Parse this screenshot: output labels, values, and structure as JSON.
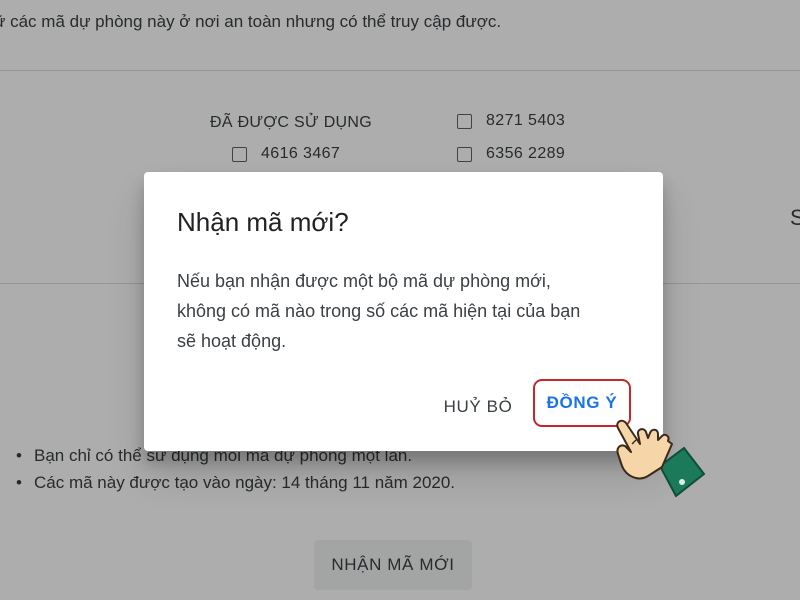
{
  "background": {
    "intro_text": "ữ các mã dự phòng này ở nơi an toàn nhưng có thể truy cập được.",
    "used_heading": "ĐÃ ĐƯỢC SỬ DỤNG",
    "codes": [
      "4616 3467",
      "8271 5403",
      "6356 2289"
    ],
    "notes": [
      "Bạn chỉ có thể sử dụng mỗi mã dự phòng một lần.",
      "Các mã này được tạo vào ngày: 14 tháng 11 năm 2020."
    ],
    "get_new_codes_label": "NHẬN MÃ MỚI",
    "right_edge_glyph": "S"
  },
  "dialog": {
    "title": "Nhận mã mới?",
    "body_lines": [
      "Nếu bạn nhận được một bộ mã dự phòng mới,",
      "không có mã nào trong số các mã hiện tại của bạn",
      "sẽ hoạt động."
    ],
    "cancel_label": "HUỶ BỎ",
    "ok_label": "ĐỒNG Ý"
  },
  "colors": {
    "accent": "#1a73e8",
    "highlight_outline": "#c62828",
    "scrim": "rgba(0,0,0,0.32)",
    "hand_skin": "#f6d6a8",
    "hand_sleeve": "#1b7a5a"
  },
  "icons": {
    "pointer": "pointing-hand-icon"
  }
}
